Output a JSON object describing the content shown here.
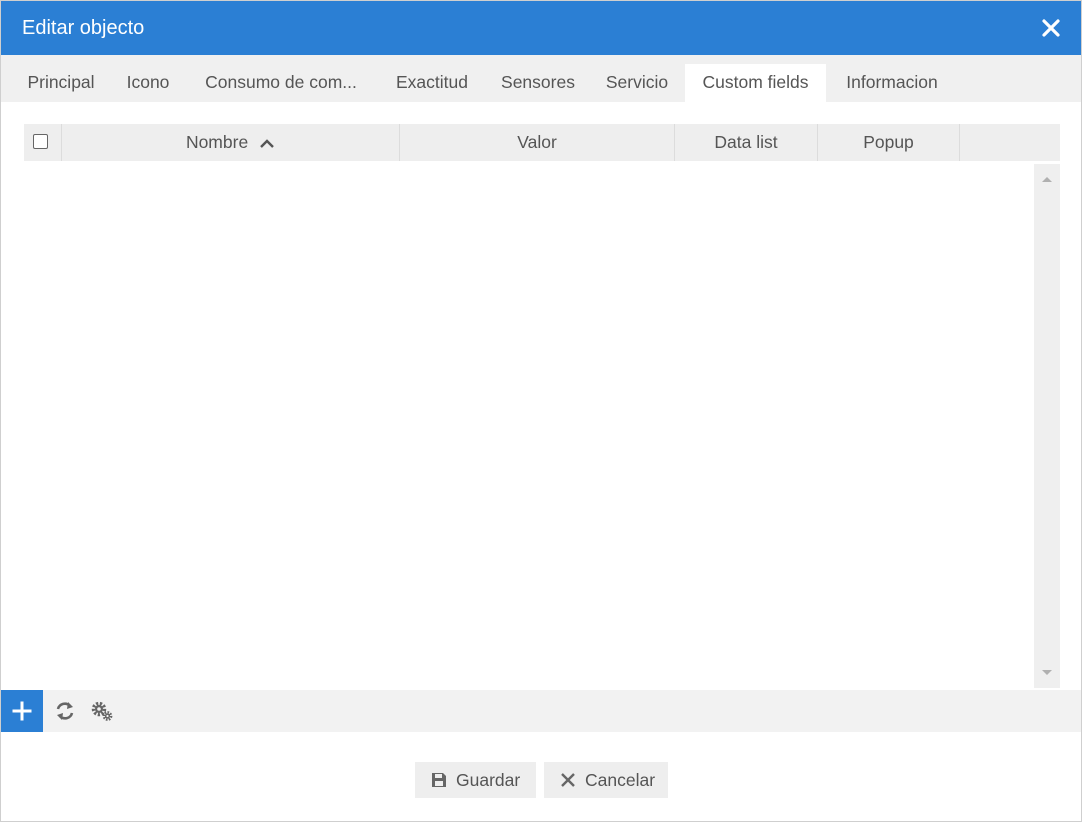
{
  "dialog": {
    "title": "Editar objecto",
    "close_icon": "close-icon"
  },
  "tabs": [
    {
      "label": "Principal",
      "active": false
    },
    {
      "label": "Icono",
      "active": false
    },
    {
      "label": "Consumo de com...",
      "active": false
    },
    {
      "label": "Exactitud",
      "active": false
    },
    {
      "label": "Sensores",
      "active": false
    },
    {
      "label": "Servicio",
      "active": false
    },
    {
      "label": "Custom fields",
      "active": true
    },
    {
      "label": "Informacion",
      "active": false
    }
  ],
  "grid": {
    "select_all_checked": false,
    "columns": [
      {
        "label": "Nombre",
        "sort": "ascending"
      },
      {
        "label": "Valor"
      },
      {
        "label": "Data list"
      },
      {
        "label": "Popup"
      }
    ],
    "rows": []
  },
  "toolbar": {
    "add_icon": "plus-icon",
    "refresh_icon": "refresh-icon",
    "settings_icon": "gears-icon"
  },
  "footer": {
    "save_label": "Guardar",
    "cancel_label": "Cancelar",
    "save_icon": "floppy-disk-icon",
    "cancel_icon": "x-icon"
  },
  "colors": {
    "accent": "#2b7fd4",
    "tabbar_bg": "#f0f0f0",
    "header_bg": "#eeeeee"
  }
}
